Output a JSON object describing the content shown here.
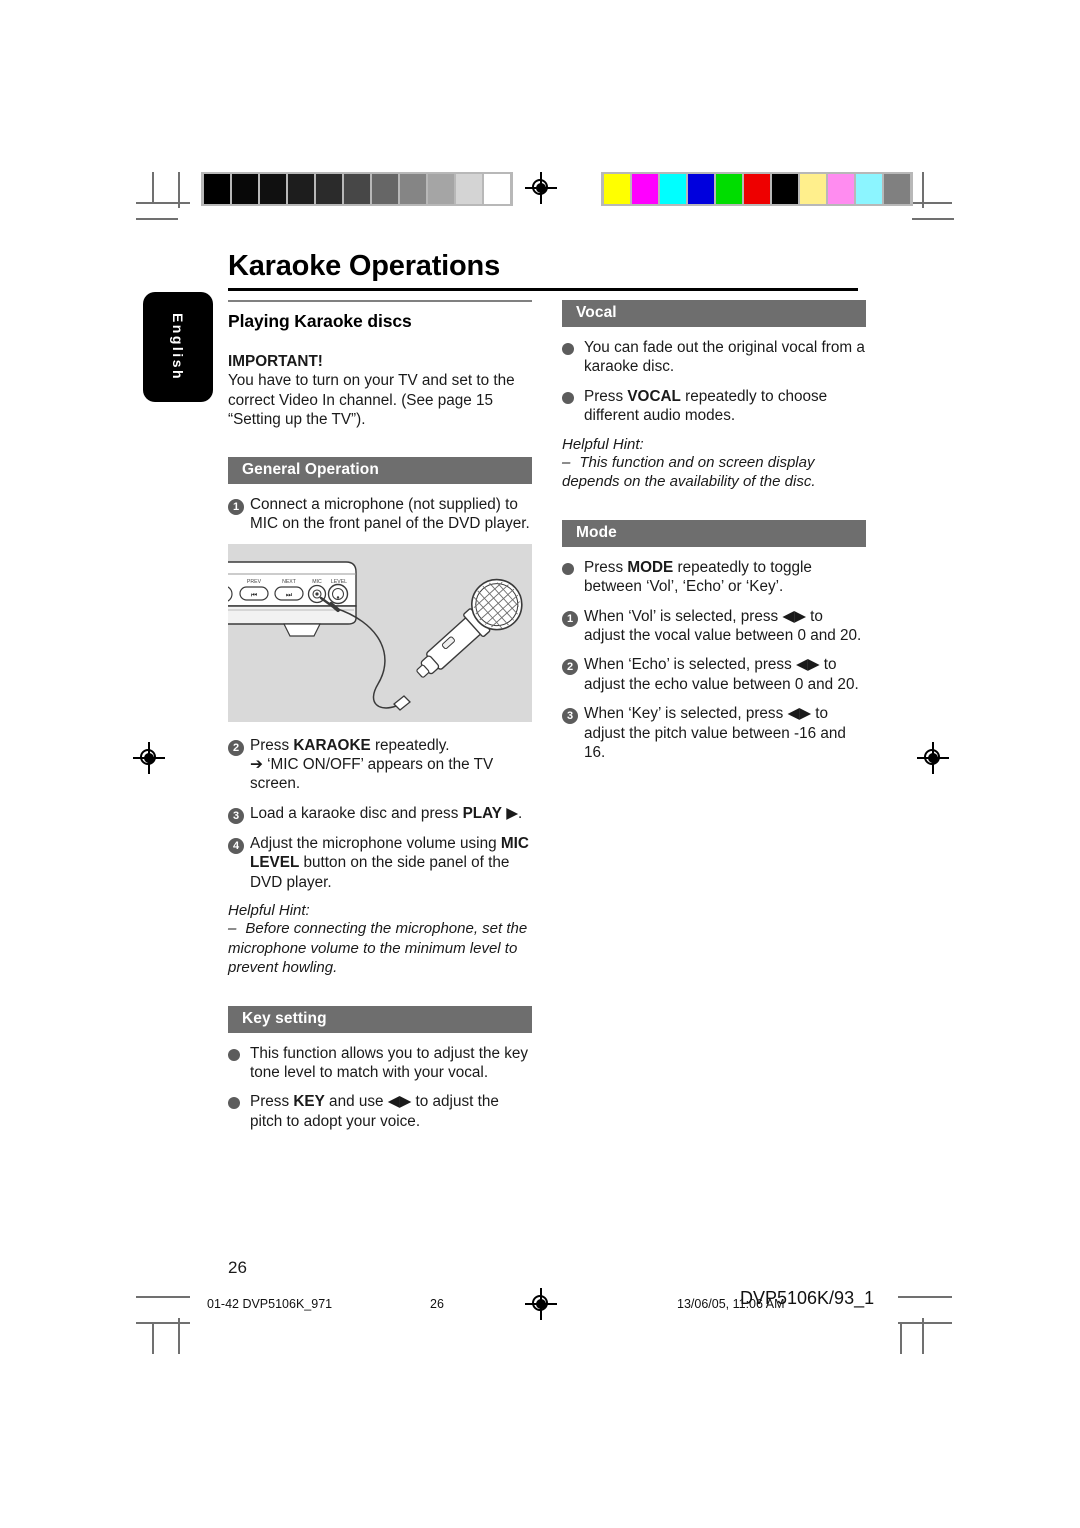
{
  "page": {
    "title": "Karaoke Operations",
    "language_tab": "English",
    "page_number": "26"
  },
  "calibration": {
    "gray_bar": [
      "#000000",
      "#080808",
      "#101010",
      "#1d1d1d",
      "#2b2b2b",
      "#474747",
      "#666666",
      "#858585",
      "#a5a5a5",
      "#d4d4d4",
      "#ffffff"
    ],
    "color_bar": [
      "#ffff00",
      "#ff00ff",
      "#00ffff",
      "#0000dd",
      "#00dd00",
      "#ee0000",
      "#000000",
      "#ffef8c",
      "#ff8cf0",
      "#8cf5ff",
      "#808080"
    ]
  },
  "left_column": {
    "sub_head": "Playing Karaoke discs",
    "important_label": "IMPORTANT!",
    "important_text": "You have to turn on your TV and set to the correct Video In channel.  (See page 15 “Setting up the TV”).",
    "general_band": "General Operation",
    "steps": [
      {
        "num": "1",
        "parts": [
          {
            "t": "Connect a microphone (not supplied) to MIC on the front panel of the DVD player.",
            "b": false
          }
        ]
      },
      {
        "num": "2",
        "parts": [
          {
            "t": "Press ",
            "b": false
          },
          {
            "t": "KARAOKE",
            "b": true
          },
          {
            "t": " repeatedly.",
            "b": false
          },
          {
            "t": "\n➔ ‘MIC ON/OFF’ appears on the TV screen.",
            "b": false
          }
        ]
      },
      {
        "num": "3",
        "parts": [
          {
            "t": "Load a karaoke disc and press ",
            "b": false
          },
          {
            "t": "PLAY",
            "b": true
          },
          {
            "t": " ▶.",
            "b": false
          }
        ]
      },
      {
        "num": "4",
        "parts": [
          {
            "t": "Adjust the microphone volume using ",
            "b": false
          },
          {
            "t": "MIC LEVEL",
            "b": true
          },
          {
            "t": " button on the side panel of the DVD player.",
            "b": false
          }
        ]
      }
    ],
    "hint_title": "Helpful Hint:",
    "hint_dash": "–",
    "hint_text": "Before connecting the microphone, set the microphone volume to the minimum level to prevent howling.",
    "key_band": "Key setting",
    "key_bullets": [
      [
        {
          "t": "This function allows you to adjust the key tone level to match with your vocal.",
          "b": false
        }
      ],
      [
        {
          "t": "Press ",
          "b": false
        },
        {
          "t": "KEY",
          "b": true
        },
        {
          "t": " and use ◀▶ to adjust the pitch to adopt your voice.",
          "b": false
        }
      ]
    ],
    "illustration": {
      "name": "microphone-connection-diagram",
      "panel_labels": [
        "PREV",
        "NEXT",
        "MIC",
        "LEVEL"
      ]
    }
  },
  "right_column": {
    "vocal_band": "Vocal",
    "vocal_bullets": [
      [
        {
          "t": "You can fade out the original vocal from a karaoke disc.",
          "b": false
        }
      ],
      [
        {
          "t": "Press ",
          "b": false
        },
        {
          "t": "VOCAL",
          "b": true
        },
        {
          "t": " repeatedly to choose different audio modes.",
          "b": false
        }
      ]
    ],
    "vocal_hint_title": "Helpful Hint:",
    "vocal_hint_dash": "–",
    "vocal_hint_text": "This function and on screen display depends on the availability of the disc.",
    "mode_band": "Mode",
    "mode_bullets": [
      [
        {
          "t": "Press ",
          "b": false
        },
        {
          "t": "MODE",
          "b": true
        },
        {
          "t": " repeatedly to toggle between ‘Vol’, ‘Echo’ or ‘Key’.",
          "b": false
        }
      ]
    ],
    "mode_steps": [
      {
        "num": "1",
        "parts": [
          {
            "t": "When ‘Vol’ is selected, press ◀▶ to adjust the vocal value between 0 and 20.",
            "b": false
          }
        ]
      },
      {
        "num": "2",
        "parts": [
          {
            "t": "When ‘Echo’ is selected, press ◀▶ to adjust the echo value between 0 and 20.",
            "b": false
          }
        ]
      },
      {
        "num": "3",
        "parts": [
          {
            "t": "When ‘Key’ is selected, press ◀▶ to adjust the pitch value between -16 and 16.",
            "b": false
          }
        ]
      }
    ]
  },
  "footer": {
    "left": "01-42 DVP5106K_971",
    "middle": "26",
    "date": "13/06/05, 11:06 AM",
    "doc_id": "DVP5106K/93_1"
  }
}
